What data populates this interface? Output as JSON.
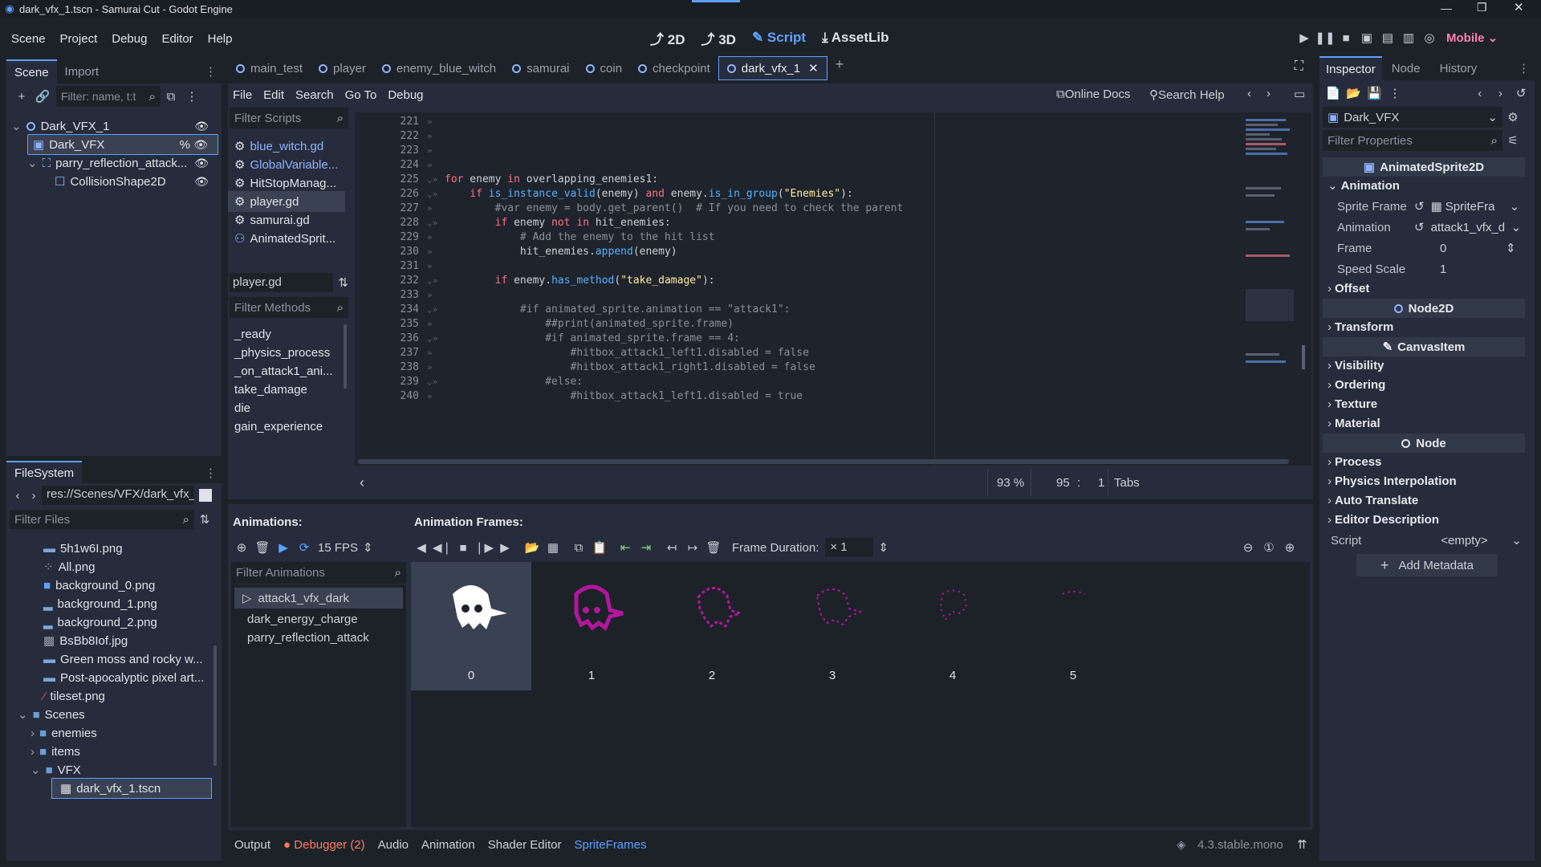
{
  "window": {
    "title": "dark_vfx_1.tscn - Samurai Cut - Godot Engine"
  },
  "menu": [
    "Scene",
    "Project",
    "Debug",
    "Editor",
    "Help"
  ],
  "workspaces": [
    {
      "label": "2D",
      "icon": "2d-icon"
    },
    {
      "label": "3D",
      "icon": "3d-icon"
    },
    {
      "label": "Script",
      "icon": "script-icon"
    },
    {
      "label": "AssetLib",
      "icon": "assetlib-icon"
    }
  ],
  "renderer": "Mobile",
  "scene_dock": {
    "tabs": [
      "Scene",
      "Import"
    ],
    "filter_placeholder": "Filter: name, t:t",
    "tree": [
      {
        "label": "Dark_VFX_1"
      },
      {
        "label": "Dark_VFX"
      },
      {
        "label": "parry_reflection_attack..."
      },
      {
        "label": "CollisionShape2D"
      }
    ]
  },
  "filesystem": {
    "title": "FileSystem",
    "path": "res://Scenes/VFX/dark_vfx_",
    "filter_placeholder": "Filter Files",
    "items": [
      "5h1w6I.png",
      "All.png",
      "background_0.png",
      "background_1.png",
      "background_2.png",
      "BsBb8Iof.jpg",
      "Green moss and rocky w...",
      "Post-apocalyptic pixel art...",
      "tileset.png",
      "Scenes",
      "enemies",
      "items",
      "VFX",
      "dark_vfx_1.tscn"
    ]
  },
  "editor_tabs": [
    "main_test",
    "player",
    "enemy_blue_witch",
    "samurai",
    "coin",
    "checkpoint",
    "dark_vfx_1"
  ],
  "script_menu": [
    "File",
    "Edit",
    "Search",
    "Go To",
    "Debug"
  ],
  "script_toolbar": {
    "online_docs": "Online Docs",
    "search_help": "Search Help"
  },
  "scripts": {
    "filter_placeholder": "Filter Scripts",
    "items": [
      "blue_witch.gd",
      "GlobalVariable...",
      "HitStopManag...",
      "player.gd",
      "samurai.gd",
      "AnimatedSprit..."
    ],
    "current": "player.gd"
  },
  "methods": {
    "filter_placeholder": "Filter Methods",
    "items": [
      "_ready",
      "_physics_process",
      "_on_attack1_ani...",
      "take_damage",
      "die",
      "gain_experience"
    ]
  },
  "code_lines": [
    {
      "n": "221",
      "t": ""
    },
    {
      "n": "222",
      "t": ""
    },
    {
      "n": "223",
      "t": ""
    },
    {
      "n": "224",
      "t": ""
    },
    {
      "n": "225",
      "t": "for enemy in overlapping_enemies1:"
    },
    {
      "n": "226",
      "t": "    if is_instance_valid(enemy) and enemy.is_in_group(\"Enemies\"):"
    },
    {
      "n": "227",
      "t": "        #var enemy = body.get_parent()  # If you need to check the parent"
    },
    {
      "n": "228",
      "t": "        if enemy not in hit_enemies:"
    },
    {
      "n": "229",
      "t": "            # Add the enemy to the hit list"
    },
    {
      "n": "230",
      "t": "            hit_enemies.append(enemy)"
    },
    {
      "n": "231",
      "t": ""
    },
    {
      "n": "232",
      "t": "        if enemy.has_method(\"take_damage\"):"
    },
    {
      "n": "233",
      "t": ""
    },
    {
      "n": "234",
      "t": "            #if animated_sprite.animation == \"attack1\":"
    },
    {
      "n": "235",
      "t": "                ##print(animated_sprite.frame)"
    },
    {
      "n": "236",
      "t": "                #if animated_sprite.frame == 4:"
    },
    {
      "n": "237",
      "t": "                    #hitbox_attack1_left1.disabled = false"
    },
    {
      "n": "238",
      "t": "                    #hitbox_attack1_right1.disabled = false"
    },
    {
      "n": "239",
      "t": "                #else:"
    },
    {
      "n": "240",
      "t": "                    #hitbox_attack1_left1.disabled = true"
    }
  ],
  "status": {
    "zoom": "93 %",
    "line": "95",
    "col": "1",
    "indent": "Tabs"
  },
  "animations": {
    "title": "Animations:",
    "frames_title": "Animation Frames:",
    "fps": "15 FPS",
    "frame_duration_label": "Frame Duration:",
    "frame_duration": "× 1",
    "filter_placeholder": "Filter Animations",
    "items": [
      "attack1_vfx_dark",
      "dark_energy_charge",
      "parry_reflection_attack"
    ],
    "frames": [
      "0",
      "1",
      "2",
      "3",
      "4",
      "5"
    ]
  },
  "bottom_tabs": [
    "Output",
    "Debugger (2)",
    "Audio",
    "Animation",
    "Shader Editor",
    "SpriteFrames"
  ],
  "version": "4.3.stable.mono",
  "inspector": {
    "tabs": [
      "Inspector",
      "Node",
      "History"
    ],
    "node": "Dark_VFX",
    "filter_placeholder": "Filter Properties",
    "class": "AnimatedSprite2D",
    "animation_section": "Animation",
    "props": [
      {
        "label": "Sprite Frame",
        "value": "SpriteFra"
      },
      {
        "label": "Animation",
        "value": "attack1_vfx_d"
      },
      {
        "label": "Frame",
        "value": "0"
      },
      {
        "label": "Speed Scale",
        "value": "1"
      }
    ],
    "offset": "Offset",
    "node2d": "Node2D",
    "transform": "Transform",
    "canvas": "CanvasItem",
    "canvas_sections": [
      "Visibility",
      "Ordering",
      "Texture",
      "Material"
    ],
    "node_cat": "Node",
    "node_sections": [
      "Process",
      "Physics Interpolation",
      "Auto Translate",
      "Editor Description"
    ],
    "script_label": "Script",
    "script_value": "<empty>",
    "add_metadata": "Add Metadata"
  },
  "colors": {
    "accent": "#5fa0ff",
    "magenta": "#b2169b",
    "debugger": "#ff7a63"
  }
}
